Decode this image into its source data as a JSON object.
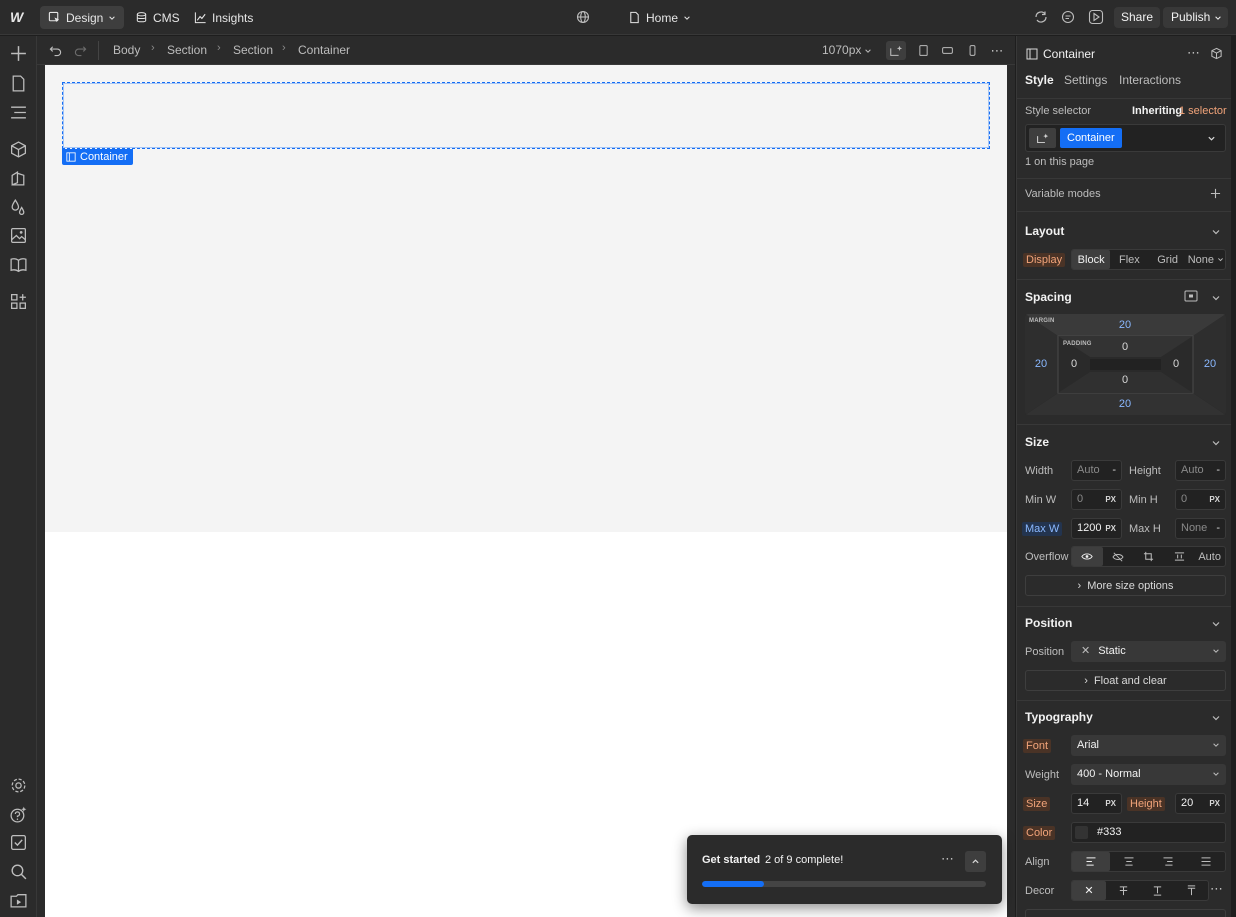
{
  "topbar": {
    "mode_design": "Design",
    "mode_cms": "CMS",
    "mode_insights": "Insights",
    "page_name": "Home",
    "share": "Share",
    "publish": "Publish"
  },
  "breadcrumb": [
    "Body",
    "Section",
    "Section",
    "Container"
  ],
  "canvas_toolbar": {
    "width_label": "1070px"
  },
  "canvas": {
    "selected_label": "Container"
  },
  "get_started": {
    "title": "Get started",
    "count": "2 of 9 complete!",
    "progress": 0.22
  },
  "panel": {
    "element_name": "Container",
    "tabs": [
      "Style",
      "Settings",
      "Interactions"
    ],
    "style_selector_label": "Style selector",
    "inheriting_prefix": "Inheriting",
    "inheriting_count": "1 selector",
    "selector_chip": "Container",
    "on_page": "1 on this page",
    "variable_modes": "Variable modes",
    "layout": {
      "title": "Layout",
      "display_label": "Display",
      "display_options": [
        "Block",
        "Flex",
        "Grid",
        "None"
      ]
    },
    "spacing": {
      "title": "Spacing",
      "margin_label": "MARGIN",
      "padding_label": "PADDING",
      "margin_top": "20",
      "margin_right": "20",
      "margin_bottom": "20",
      "margin_left": "20",
      "padding_top": "0",
      "padding_right": "0",
      "padding_bottom": "0",
      "padding_left": "0"
    },
    "size": {
      "title": "Size",
      "width_label": "Width",
      "width_value": "Auto",
      "width_unit": "-",
      "height_label": "Height",
      "height_value": "Auto",
      "height_unit": "-",
      "minw_label": "Min W",
      "minw_value": "0",
      "minw_unit": "PX",
      "minh_label": "Min H",
      "minh_value": "0",
      "minh_unit": "PX",
      "maxw_label": "Max W",
      "maxw_value": "1200",
      "maxw_unit": "PX",
      "maxh_label": "Max H",
      "maxh_value": "None",
      "maxh_unit": "-",
      "overflow_label": "Overflow",
      "overflow_auto": "Auto",
      "more_options": "More size options"
    },
    "position": {
      "title": "Position",
      "position_label": "Position",
      "position_value": "Static",
      "float_clear": "Float and clear"
    },
    "typography": {
      "title": "Typography",
      "font_label": "Font",
      "font_value": "Arial",
      "weight_label": "Weight",
      "weight_value": "400 - Normal",
      "size_label": "Size",
      "size_value": "14",
      "size_unit": "PX",
      "height_label": "Height",
      "height_value": "20",
      "height_unit": "PX",
      "color_label": "Color",
      "color_value": "#333",
      "align_label": "Align",
      "decor_label": "Decor"
    }
  },
  "colors": {
    "accent": "#146ef5",
    "panel_bg": "#2b2b2b",
    "canvas_section": "#f4f4f4"
  }
}
